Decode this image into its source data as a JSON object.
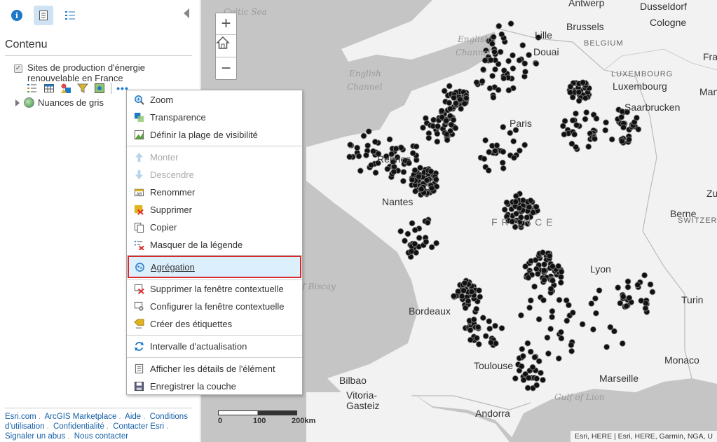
{
  "sidebar": {
    "title": "Contenu",
    "layer_name": "Sites de production d'énergie renouvelable en France",
    "layer_checked": true,
    "basemap_name": "Nuances de gris",
    "more_label": "•••",
    "footer_links": [
      "Esri.com",
      "ArcGIS Marketplace",
      "Aide",
      "Conditions d'utilisation",
      "Confidentialité",
      "Contacter Esri",
      "Signaler un abus",
      "Nous contacter"
    ]
  },
  "context_menu": {
    "items": [
      {
        "label": "Zoom",
        "icon": "zoom-icon"
      },
      {
        "label": "Transparence",
        "icon": "transparency-icon"
      },
      {
        "label": "Définir la plage de visibilité",
        "icon": "visibility-range-icon"
      },
      {
        "label": "Monter",
        "icon": "arrow-up-icon",
        "disabled": true
      },
      {
        "label": "Descendre",
        "icon": "arrow-down-icon",
        "disabled": true
      },
      {
        "label": "Renommer",
        "icon": "rename-icon"
      },
      {
        "label": "Supprimer",
        "icon": "remove-icon"
      },
      {
        "label": "Copier",
        "icon": "copy-icon"
      },
      {
        "label": "Masquer de la légende",
        "icon": "hide-legend-icon"
      },
      {
        "label": "Agrégation",
        "icon": "clustering-icon",
        "selected": true
      },
      {
        "label": "Supprimer la fenêtre contextuelle",
        "icon": "remove-popup-icon"
      },
      {
        "label": "Configurer la fenêtre contextuelle",
        "icon": "configure-popup-icon"
      },
      {
        "label": "Créer des étiquettes",
        "icon": "labels-icon"
      },
      {
        "label": "Intervalle d'actualisation",
        "icon": "refresh-icon"
      },
      {
        "label": "Afficher les détails de l'élément",
        "icon": "item-details-icon"
      },
      {
        "label": "Enregistrer la couche",
        "icon": "save-layer-icon"
      }
    ]
  },
  "map": {
    "labels": {
      "celtic_sea": "Celtic Sea",
      "english_channel_1": "English",
      "english_channel_2": "Channel",
      "english_channel_3": "English",
      "english_channel_4": "Channel",
      "antwerp": "Antwerp",
      "dusseldorf": "Dusseldorf",
      "cologne": "Cologne",
      "brussels": "Brussels",
      "belgium": "BELGIUM",
      "lille": "Lille",
      "douai": "Douai",
      "luxembourg_country": "LUXEMBOURG",
      "luxembourg": "Luxembourg",
      "mann": "Mann",
      "fra": "Fra",
      "saarbrucken": "Saarbrucken",
      "paris": "Paris",
      "rennes": "Rennes",
      "nantes": "Nantes",
      "france": "FRANCE",
      "bern": "Berne",
      "switzer": "SWITZER",
      "zu": "Zu",
      "lyon": "Lyon",
      "bay_of_biscay": "of Biscay",
      "bordeaux": "Bordeaux",
      "turin": "Turin",
      "monaco": "Monaco",
      "toulouse": "Toulouse",
      "marseille": "Marseille",
      "gulf_of_lion": "Gulf of Lion",
      "bilbao": "Bilbao",
      "vitoria_1": "Vitoria-",
      "vitoria_2": "Gasteiz",
      "andorra": "Andorra"
    },
    "scale": {
      "label_0": "0",
      "label_100": "100",
      "label_200": "200km"
    },
    "attribution": "Esri, HERE | Esri, HERE, Garmin, NGA, U"
  },
  "colors": {
    "accent": "#1e78c8",
    "highlight_border": "#d9292b",
    "highlight_bg": "#dceffc",
    "land": "#f2f2f2",
    "water": "#c5c5c5",
    "point": "#111111"
  }
}
